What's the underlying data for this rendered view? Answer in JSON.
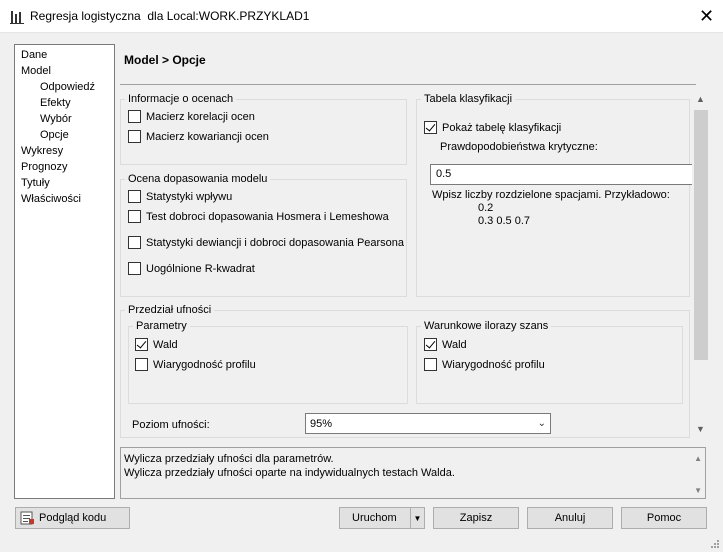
{
  "window": {
    "title": "Regresja logistyczna  dla Local:WORK.PRZYKLAD1",
    "close": "✕"
  },
  "nav": {
    "items": [
      "Dane",
      "Model",
      "Odpowiedź",
      "Efekty",
      "Wybór",
      "Opcje",
      "Wykresy",
      "Prognozy",
      "Tytuły",
      "Właściwości"
    ]
  },
  "header": {
    "title": "Model > Opcje"
  },
  "info_group": {
    "legend": "Informacje o ocenach",
    "corr": {
      "label": "Macierz korelacji ocen",
      "checked": false
    },
    "cov": {
      "label": "Macierz kowariancji ocen",
      "checked": false
    }
  },
  "fit_group": {
    "legend": "Ocena dopasowania modelu",
    "influence": {
      "label": "Statystyki wpływu",
      "checked": false
    },
    "hosmer": {
      "label": "Test dobroci dopasowania Hosmera i Lemeshowa",
      "checked": false
    },
    "deviance": {
      "label": "Statystyki dewiancji i dobroci dopasowania Pearsona",
      "checked": false
    },
    "rsq": {
      "label": "Uogólnione R-kwadrat",
      "checked": false
    }
  },
  "class_group": {
    "legend": "Tabela klasyfikacji",
    "show": {
      "label": "Pokaż tabelę klasyfikacji",
      "checked": true
    },
    "prob_label": "Prawdopodobieństwa krytyczne:",
    "prob_value": "0.5",
    "hint": "Wpisz liczby rozdzielone spacjami. Przykładowo:",
    "example1": "0.2",
    "example2": "0.3 0.5 0.7"
  },
  "ci_group": {
    "legend": "Przedział ufności",
    "params": {
      "legend": "Parametry",
      "wald": {
        "label": "Wald",
        "checked": true
      },
      "profile": {
        "label": "Wiarygodność profilu",
        "checked": false
      }
    },
    "odds": {
      "legend": "Warunkowe ilorazy szans",
      "wald": {
        "label": "Wald",
        "checked": true
      },
      "profile": {
        "label": "Wiarygodność profilu",
        "checked": false
      }
    },
    "level_label": "Poziom ufności:",
    "level_value": "95%"
  },
  "description": {
    "line1": "Wylicza przedziały ufności dla parametrów.",
    "line2": "Wylicza przedziały ufności oparte na indywidualnych testach Walda."
  },
  "buttons": {
    "preview": "Podgląd kodu",
    "run": "Uruchom",
    "save": "Zapisz",
    "cancel": "Anuluj",
    "help": "Pomoc"
  }
}
